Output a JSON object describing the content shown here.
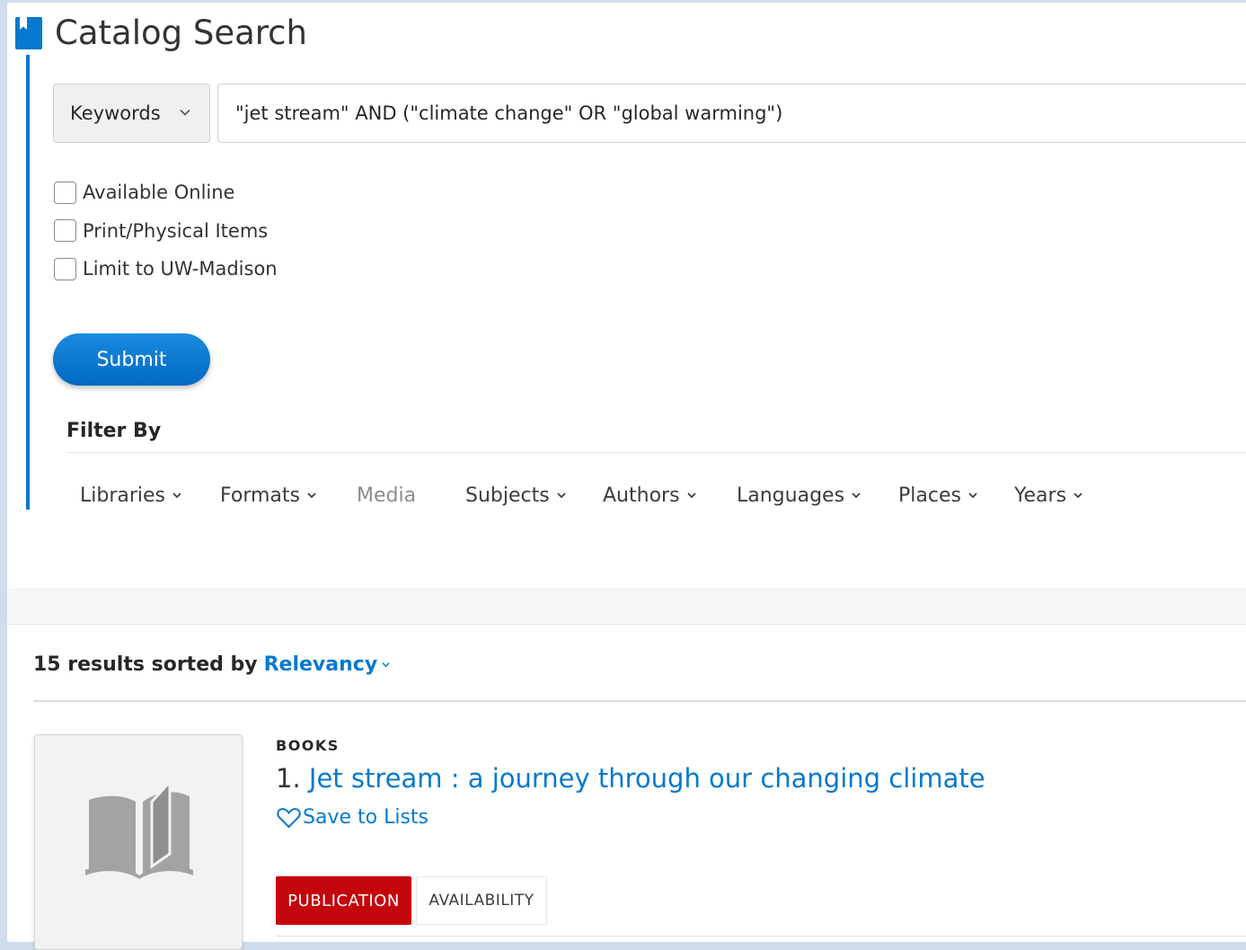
{
  "header": {
    "title": "Catalog Search",
    "icon": "bookmark-book-icon",
    "accent_color": "#0479ce"
  },
  "search": {
    "scope_selected": "Keywords",
    "query_value": "\"jet stream\" AND (\"climate change\" OR \"global warming\")",
    "checkboxes": [
      {
        "label": "Available Online",
        "checked": false
      },
      {
        "label": "Print/Physical Items",
        "checked": false
      },
      {
        "label": "Limit to UW-Madison",
        "checked": false
      }
    ],
    "submit_label": "Submit"
  },
  "filters": {
    "title": "Filter By",
    "items": [
      {
        "label": "Libraries",
        "enabled": true
      },
      {
        "label": "Formats",
        "enabled": true
      },
      {
        "label": "Media",
        "enabled": false
      },
      {
        "label": "Subjects",
        "enabled": true
      },
      {
        "label": "Authors",
        "enabled": true
      },
      {
        "label": "Languages",
        "enabled": true
      },
      {
        "label": "Places",
        "enabled": true
      },
      {
        "label": "Years",
        "enabled": true
      }
    ]
  },
  "results": {
    "summary": "15 results sorted by",
    "sort_label": "Relevancy",
    "items": [
      {
        "format": "BOOKS",
        "number": "1.",
        "title": "Jet stream : a journey through our changing climate",
        "save_label": "Save to Lists",
        "tabs": [
          {
            "label": "PUBLICATION",
            "active": true
          },
          {
            "label": "AVAILABILITY",
            "active": false
          }
        ]
      }
    ]
  },
  "colors": {
    "link": "#0479ce",
    "active_tab": "#c5050c",
    "background": "#cfdcec"
  }
}
